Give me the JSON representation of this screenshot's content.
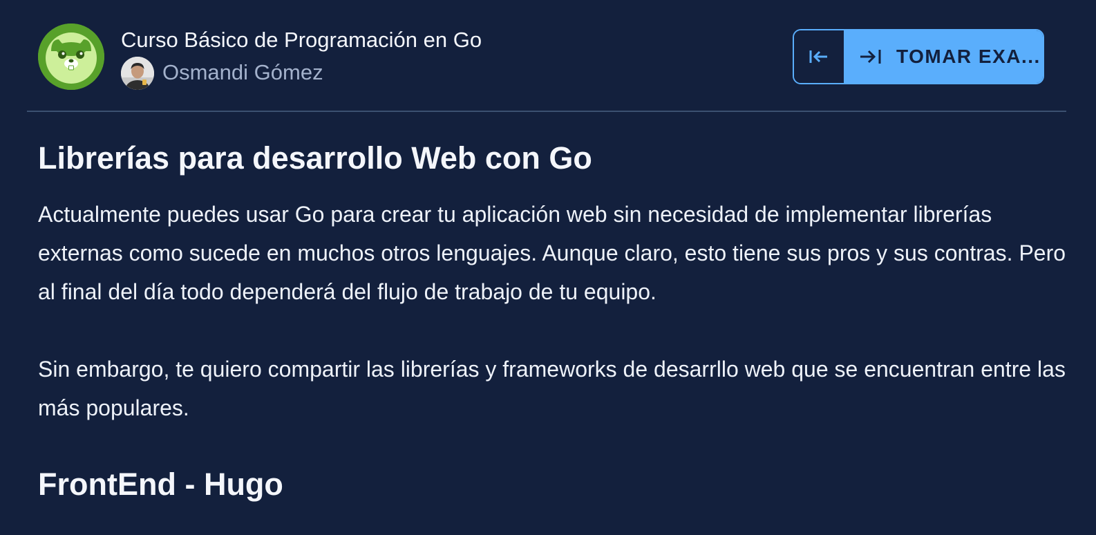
{
  "header": {
    "course_title": "Curso Básico de Programación en Go",
    "teacher_name": "Osmandi Gómez",
    "logo_icon": "gopher-icon",
    "avatar_icon": "teacher-avatar",
    "prev_icon": "arrow-to-left-icon",
    "next_icon": "arrow-to-right-icon",
    "next_label": "TOMAR EXA..."
  },
  "lesson": {
    "title": "Librerías para desarrollo Web con Go",
    "paragraphs": [
      "Actualmente puedes usar Go para crear tu aplicación web sin necesidad de implementar librerías externas como sucede en muchos otros lenguajes. Aunque claro, esto tiene sus pros y sus contras. Pero al final del día todo dependerá del flujo de trabajo de tu equipo.",
      "Sin embargo, te quiero compartir las librerías y frameworks de desarrllo web que se encuentran entre las más populares."
    ],
    "section_heading": "FrontEnd - Hugo"
  },
  "colors": {
    "background": "#13203d",
    "accent": "#5aaefc",
    "divider": "#3b5070",
    "muted_text": "#a4b2cc",
    "logo_green": "#58a12a"
  }
}
